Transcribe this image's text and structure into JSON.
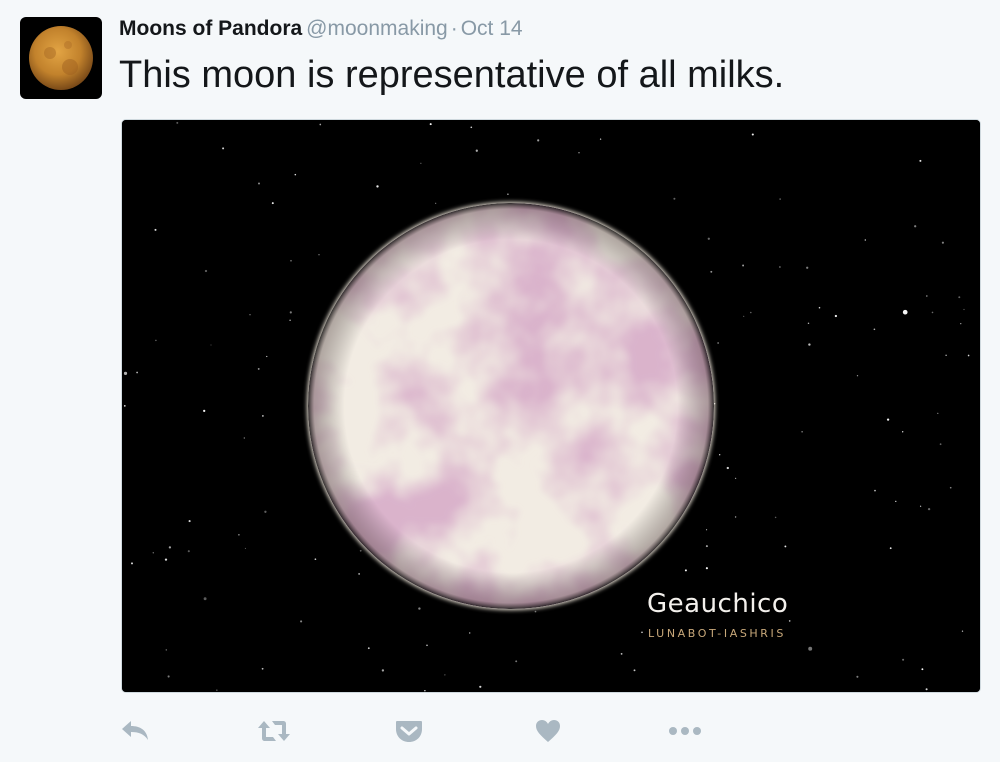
{
  "tweet": {
    "author": {
      "display_name": "Moons of Pandora",
      "handle": "@moonmaking"
    },
    "separator": "·",
    "date": "Oct 14",
    "text": "This moon is representative of all milks.",
    "media": {
      "moon_name": "Geauchico",
      "credit": "LUNABOT-IASHRIS"
    },
    "actions": [
      {
        "name": "reply",
        "icon": "reply-icon"
      },
      {
        "name": "retweet",
        "icon": "retweet-icon"
      },
      {
        "name": "save",
        "icon": "pocket-icon"
      },
      {
        "name": "like",
        "icon": "heart-icon"
      },
      {
        "name": "more",
        "icon": "more-icon"
      }
    ]
  },
  "colors": {
    "background": "#f5f8fa",
    "text": "#14171a",
    "muted": "#8899a6",
    "action_icons": "#aab8c2",
    "moon_pink": "#c08aa8",
    "moon_cream": "#f2ece3"
  }
}
